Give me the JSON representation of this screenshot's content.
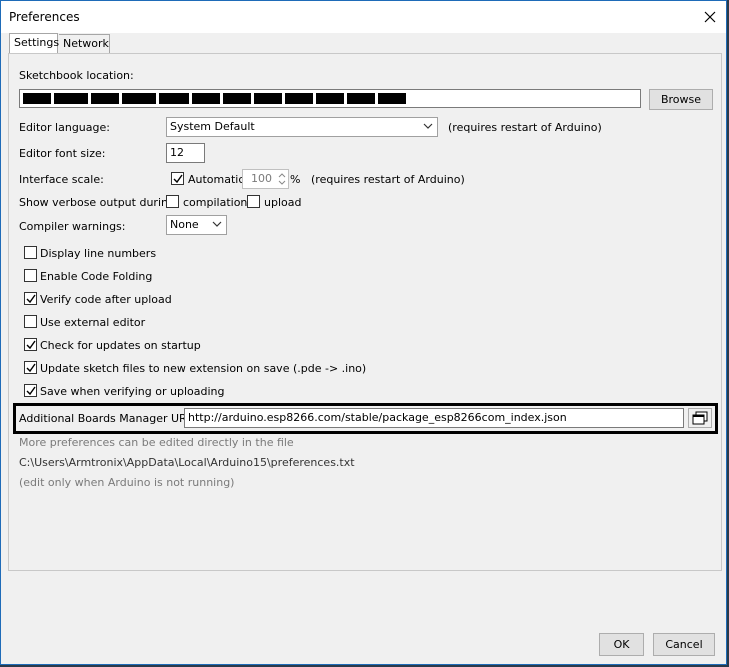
{
  "window": {
    "title": "Preferences"
  },
  "tabs": [
    {
      "label": "Settings"
    },
    {
      "label": "Network"
    }
  ],
  "sketchbook": {
    "label": "Sketchbook location:",
    "browse_label": "Browse"
  },
  "editor_language": {
    "label": "Editor language:",
    "value": "System Default",
    "note": "(requires restart of Arduino)"
  },
  "editor_font_size": {
    "label": "Editor font size:",
    "value": "12"
  },
  "interface_scale": {
    "label": "Interface scale:",
    "automatic_label": "Automatic",
    "automatic_checked": true,
    "value": "100",
    "unit": "%",
    "note": "(requires restart of Arduino)"
  },
  "verbose": {
    "label": "Show verbose output during:",
    "compilation_label": "compilation",
    "compilation_checked": false,
    "upload_label": "upload",
    "upload_checked": false
  },
  "compiler_warnings": {
    "label": "Compiler warnings:",
    "value": "None"
  },
  "options": [
    {
      "label": "Display line numbers",
      "checked": false
    },
    {
      "label": "Enable Code Folding",
      "checked": false
    },
    {
      "label": "Verify code after upload",
      "checked": true
    },
    {
      "label": "Use external editor",
      "checked": false
    },
    {
      "label": "Check for updates on startup",
      "checked": true
    },
    {
      "label": "Update sketch files to new extension on save (.pde -> .ino)",
      "checked": true
    },
    {
      "label": "Save when verifying or uploading",
      "checked": true
    }
  ],
  "boards_urls": {
    "label": "Additional Boards Manager URLs:",
    "value": "http://arduino.esp8266.com/stable/package_esp8266com_index.json"
  },
  "more_prefs": {
    "line1": "More preferences can be edited directly in the file",
    "path": "C:\\Users\\Armtronix\\AppData\\Local\\Arduino15\\preferences.txt",
    "line3": "(edit only when Arduino is not running)"
  },
  "footer": {
    "ok_label": "OK",
    "cancel_label": "Cancel"
  },
  "colors": {
    "window_border": "#1e6bb8",
    "panel_bg": "#f0f0f0",
    "highlight_frame": "#000000"
  }
}
